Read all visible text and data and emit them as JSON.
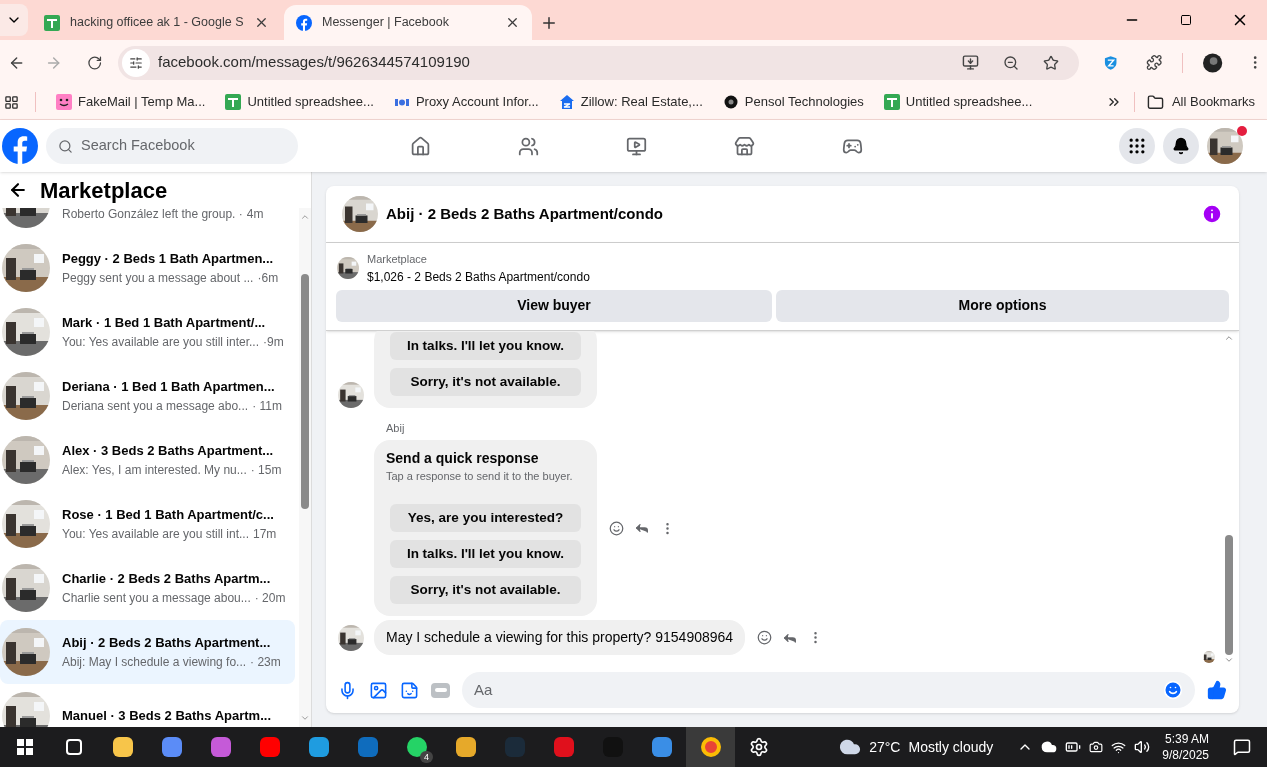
{
  "browser": {
    "tabs": [
      {
        "title": "hacking officee ak 1 - Google S",
        "kind": "sheets",
        "selected": false
      },
      {
        "title": "Messenger | Facebook",
        "kind": "facebook",
        "selected": true
      }
    ],
    "address": "facebook.com/messages/t/9626344574109190",
    "bookmarks": [
      {
        "label": "FakeMail | Temp Ma...",
        "kind": "smiley"
      },
      {
        "label": "Untitled spreadshee...",
        "kind": "sheets"
      },
      {
        "label": "Proxy Account Infor...",
        "kind": "proxy"
      },
      {
        "label": "Zillow: Real Estate,...",
        "kind": "house"
      },
      {
        "label": "Pensol Technologies",
        "kind": "pensol"
      },
      {
        "label": "Untitled spreadshee...",
        "kind": "sheets"
      }
    ],
    "all_bookmarks": "All Bookmarks"
  },
  "facebook": {
    "search": {
      "placeholder": "Search Facebook"
    },
    "notification_dot": true
  },
  "sidebar": {
    "title": "Marketplace",
    "conversations": [
      {
        "preview": "Roberto González left the group. ·",
        "time": "4m",
        "selected": false
      },
      {
        "title": "Peggy · 2 Beds 1 Bath Apartmen...",
        "preview": "Peggy sent you a message about ...",
        "time": "·6m",
        "selected": false
      },
      {
        "title": "Mark · 1 Bed 1 Bath Apartment/...",
        "preview": "You: Yes available are you still inter...",
        "time": "·9m",
        "selected": false
      },
      {
        "title": "Deriana · 1 Bed 1 Bath Apartmen...",
        "preview": "Deriana sent you a message abo...",
        "time": "· 11m",
        "selected": false
      },
      {
        "title": "Alex · 3 Beds 2 Baths Apartment...",
        "preview": "Alex: Yes, I am interested. My nu...",
        "time": "· 15m",
        "selected": false
      },
      {
        "title": "Rose · 1 Bed 1 Bath Apartment/c...",
        "preview": "You: Yes available are you still int...",
        "time": "17m",
        "selected": false
      },
      {
        "title": "Charlie · 2 Beds 2 Baths Apartm...",
        "preview": "Charlie sent you a message abou...",
        "time": "· 20m",
        "selected": false
      },
      {
        "title": "Abij · 2 Beds 2 Baths Apartment...",
        "preview": "Abij: May I schedule a viewing fo...",
        "time": "· 23m",
        "selected": true
      },
      {
        "title": "Manuel · 3 Beds 2 Baths Apartm...",
        "selected": false
      }
    ]
  },
  "chat": {
    "title": "Abij · 2 Beds 2 Baths Apartment/condo",
    "listing": {
      "label": "Marketplace",
      "text": "$1,026 - 2 Beds 2 Baths Apartment/condo"
    },
    "buttons": [
      "View buyer",
      "More options"
    ],
    "messages": [
      {
        "kind": "quick_response",
        "show_actions": false,
        "options": [
          "In talks. I'll let you know.",
          "Sorry, it's not available."
        ]
      },
      {
        "kind": "quick_response",
        "sender": "Abij",
        "title": "Send a quick response",
        "subtitle": "Tap a response to send it to the buyer.",
        "show_actions": true,
        "options": [
          "Yes, are you interested?",
          "In talks. I'll let you know.",
          "Sorry, it's not available."
        ]
      },
      {
        "kind": "text",
        "text": "May I schedule a viewing for this property? 9154908964",
        "show_actions": true
      }
    ],
    "composer": {
      "placeholder": "Aa"
    }
  },
  "taskbar": {
    "whatsapp_badge": "4",
    "temperature": "27°C",
    "weather": "Mostly cloudy",
    "time": "5:39 AM",
    "date": "9/8/2025"
  }
}
